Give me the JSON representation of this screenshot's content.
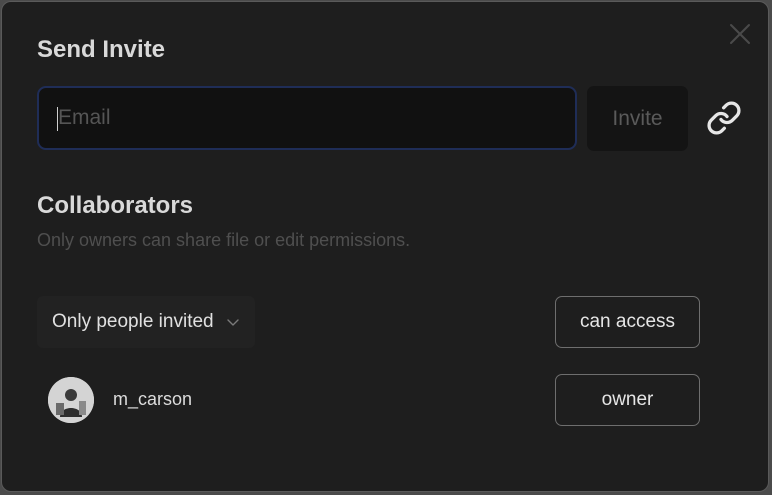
{
  "dialog": {
    "title": "Send Invite",
    "close_icon": "close-icon"
  },
  "invite": {
    "email_placeholder": "Email",
    "email_value": "",
    "button_label": "Invite",
    "link_icon": "link-icon"
  },
  "collaborators": {
    "title": "Collaborators",
    "subtitle": "Only owners can share file or edit permissions.",
    "general_access": {
      "selected": "Only people invited",
      "permission": "can access"
    },
    "users": [
      {
        "username": "m_carson",
        "permission": "owner",
        "avatar_icon": "user-avatar"
      }
    ]
  },
  "colors": {
    "background": "#1e1e1e",
    "input_border": "#1f2d57",
    "text_primary": "#d9d9d9",
    "text_muted": "#4f4f4f"
  }
}
